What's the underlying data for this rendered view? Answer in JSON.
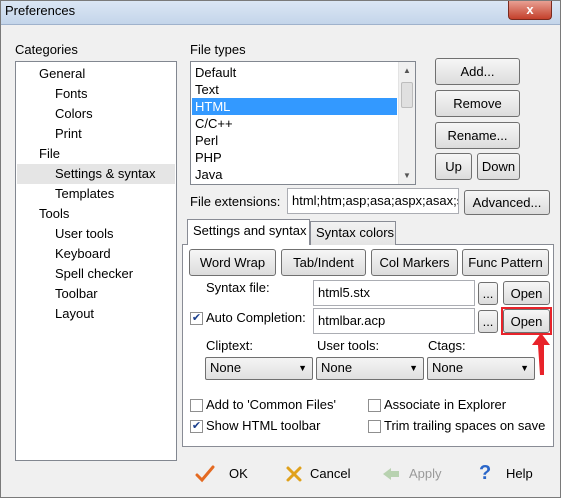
{
  "window": {
    "title": "Preferences",
    "close_label": "x"
  },
  "categories": {
    "label": "Categories",
    "items": [
      {
        "label": "General",
        "level": 0
      },
      {
        "label": "Fonts",
        "level": 1
      },
      {
        "label": "Colors",
        "level": 1
      },
      {
        "label": "Print",
        "level": 1
      },
      {
        "label": "File",
        "level": 0
      },
      {
        "label": "Settings & syntax",
        "level": 1,
        "selected": true
      },
      {
        "label": "Templates",
        "level": 1
      },
      {
        "label": "Tools",
        "level": 0
      },
      {
        "label": "User tools",
        "level": 1
      },
      {
        "label": "Keyboard",
        "level": 1
      },
      {
        "label": "Spell checker",
        "level": 1
      },
      {
        "label": "Toolbar",
        "level": 1
      },
      {
        "label": "Layout",
        "level": 1
      }
    ]
  },
  "file_types": {
    "label": "File types",
    "items": [
      "Default",
      "Text",
      "HTML",
      "C/C++",
      "Perl",
      "PHP",
      "Java"
    ],
    "selected": "HTML",
    "buttons": {
      "add": "Add...",
      "remove": "Remove",
      "rename": "Rename...",
      "up": "Up",
      "down": "Down"
    }
  },
  "extensions": {
    "label": "File extensions:",
    "value": "html;htm;asp;asa;aspx;asax;s",
    "advanced": "Advanced..."
  },
  "tabs": {
    "settings": "Settings and syntax",
    "syntax_colors": "Syntax colors"
  },
  "actions": {
    "word_wrap": "Word Wrap",
    "tab_indent": "Tab/Indent",
    "col_markers": "Col Markers",
    "func_pattern": "Func Pattern"
  },
  "syntax_file": {
    "label": "Syntax file:",
    "value": "html5.stx",
    "browse": "...",
    "open": "Open"
  },
  "auto_completion": {
    "label": "Auto Completion:",
    "checked": true,
    "value": "htmlbar.acp",
    "browse": "...",
    "open": "Open"
  },
  "dropdowns": {
    "cliptext": {
      "label": "Cliptext:",
      "value": "None"
    },
    "user_tools": {
      "label": "User tools:",
      "value": "None"
    },
    "ctags": {
      "label": "Ctags:",
      "value": "None"
    }
  },
  "checkboxes": {
    "common_files": {
      "label": "Add to 'Common Files'",
      "checked": false
    },
    "associate": {
      "label": "Associate in Explorer",
      "checked": false
    },
    "show_toolbar": {
      "label": "Show HTML toolbar",
      "checked": true
    },
    "trim_spaces": {
      "label": "Trim trailing spaces on save",
      "checked": false
    }
  },
  "footer": {
    "ok": "OK",
    "cancel": "Cancel",
    "apply": "Apply",
    "help": "Help"
  },
  "annotation": {
    "highlight_color": "#e8232a"
  }
}
